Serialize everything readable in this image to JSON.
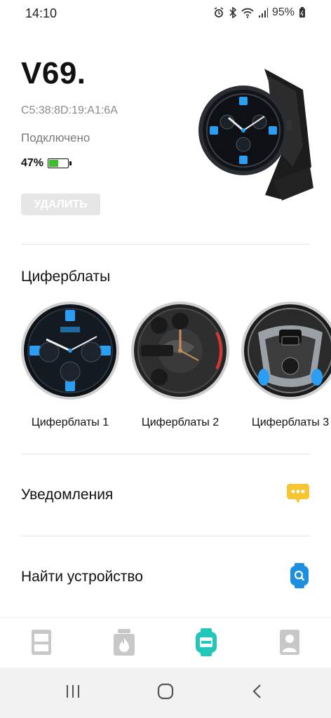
{
  "status_bar": {
    "time": "14:10",
    "battery": "95%",
    "icons": [
      "alarm-icon",
      "bluetooth-icon",
      "wifi-icon",
      "signal-icon",
      "battery-icon"
    ]
  },
  "device": {
    "name": "V69.",
    "mac": "C5:38:8D:19:A1:6A",
    "connection": "Подключено",
    "battery": "47%",
    "battery_level": 0.47,
    "remove_label": "УДАЛИТЬ"
  },
  "watchfaces": {
    "title": "Циферблаты",
    "items": [
      {
        "label": "Циферблаты 1"
      },
      {
        "label": "Циферблаты 2"
      },
      {
        "label": "Циферблаты 3"
      }
    ]
  },
  "notifications": {
    "label": "Уведомления",
    "icon": "chat-bubble-icon",
    "color": "#f7c531"
  },
  "find_device": {
    "label": "Найти устройство",
    "icon": "search-watch-icon",
    "color": "#1e8fe0"
  },
  "tabbar": {
    "active_color": "#21c7b8",
    "inactive_color": "#c8c8c8",
    "tabs": [
      {
        "icon": "dashboard-icon",
        "active": false
      },
      {
        "icon": "fitness-icon",
        "active": false
      },
      {
        "icon": "watch-icon",
        "active": true
      },
      {
        "icon": "profile-icon",
        "active": false
      }
    ]
  },
  "navbar": {
    "buttons": [
      "recents-icon",
      "home-icon",
      "back-icon"
    ]
  }
}
